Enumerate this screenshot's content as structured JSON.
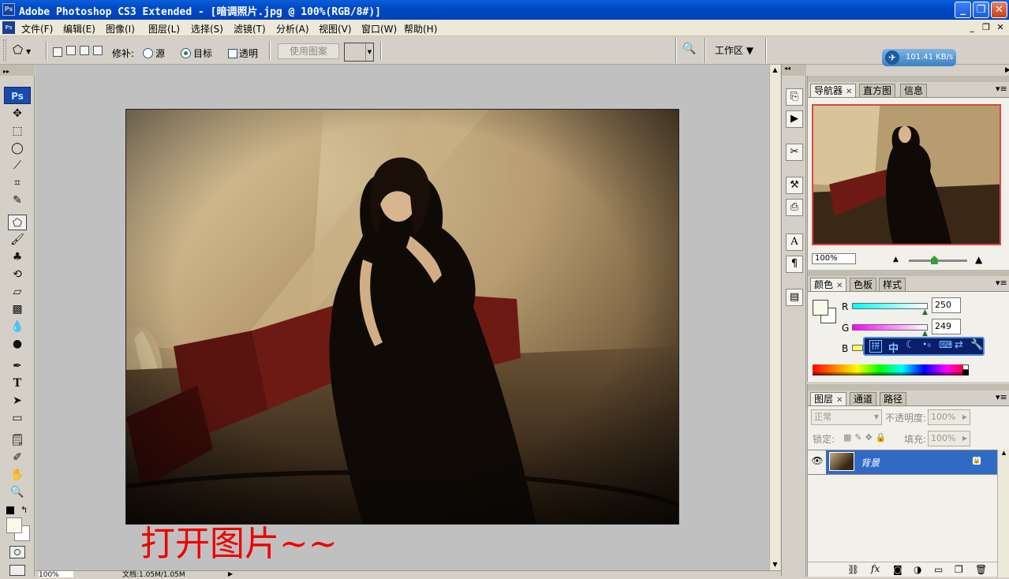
{
  "window": {
    "app_icon": "Ps",
    "title": "Adobe Photoshop CS3 Extended - [暗调照片.jpg @ 100%(RGB/8#)]",
    "buttons": [
      "minimize",
      "restore",
      "close"
    ]
  },
  "menu": {
    "items": [
      "文件(F)",
      "编辑(E)",
      "图像(I)",
      "图层(L)",
      "选择(S)",
      "滤镜(T)",
      "分析(A)",
      "视图(V)",
      "窗口(W)",
      "帮助(H)"
    ]
  },
  "options": {
    "patch_label": "修补:",
    "source_label": "源",
    "target_label": "目标",
    "transparent_label": "透明",
    "use_pattern_label": "使用图案",
    "workspace_label": "工作区 ▼",
    "selected_mode": "目标"
  },
  "network_speed": "101.41 KB/s",
  "tools": {
    "ps_logo": "Ps",
    "active_tool": "patch-tool"
  },
  "document": {
    "caption": "打开图片~~",
    "status_zoom": "100%",
    "status_doc": "文档:1.05M/1.05M"
  },
  "navigator": {
    "tabs": [
      "导航器",
      "直方图",
      "信息"
    ],
    "zoom": "100%",
    "zoom_slider_fraction": 0.43
  },
  "color": {
    "tabs": [
      "颜色",
      "色板",
      "样式"
    ],
    "r_label": "R",
    "g_label": "G",
    "b_label": "B",
    "r_value": "250",
    "g_value": "249",
    "foreground": "#fafae9",
    "background": "#ffffff",
    "ime_bar": {
      "logo": "拼",
      "mode": "中"
    }
  },
  "layers": {
    "tabs": [
      "图层",
      "通道",
      "路径"
    ],
    "blend_mode": "正常",
    "opacity_label": "不透明度:",
    "opacity_value": "100%",
    "lock_label": "锁定:",
    "fill_label": "填充:",
    "fill_value": "100%",
    "items": [
      {
        "name": "背景",
        "visible": true,
        "locked": true,
        "selected": true
      }
    ],
    "footer_icons": [
      "link-layers-icon",
      "fx-icon",
      "add-mask-icon",
      "adjustment-layer-icon",
      "new-group-icon",
      "new-layer-icon",
      "delete-layer-icon"
    ]
  }
}
